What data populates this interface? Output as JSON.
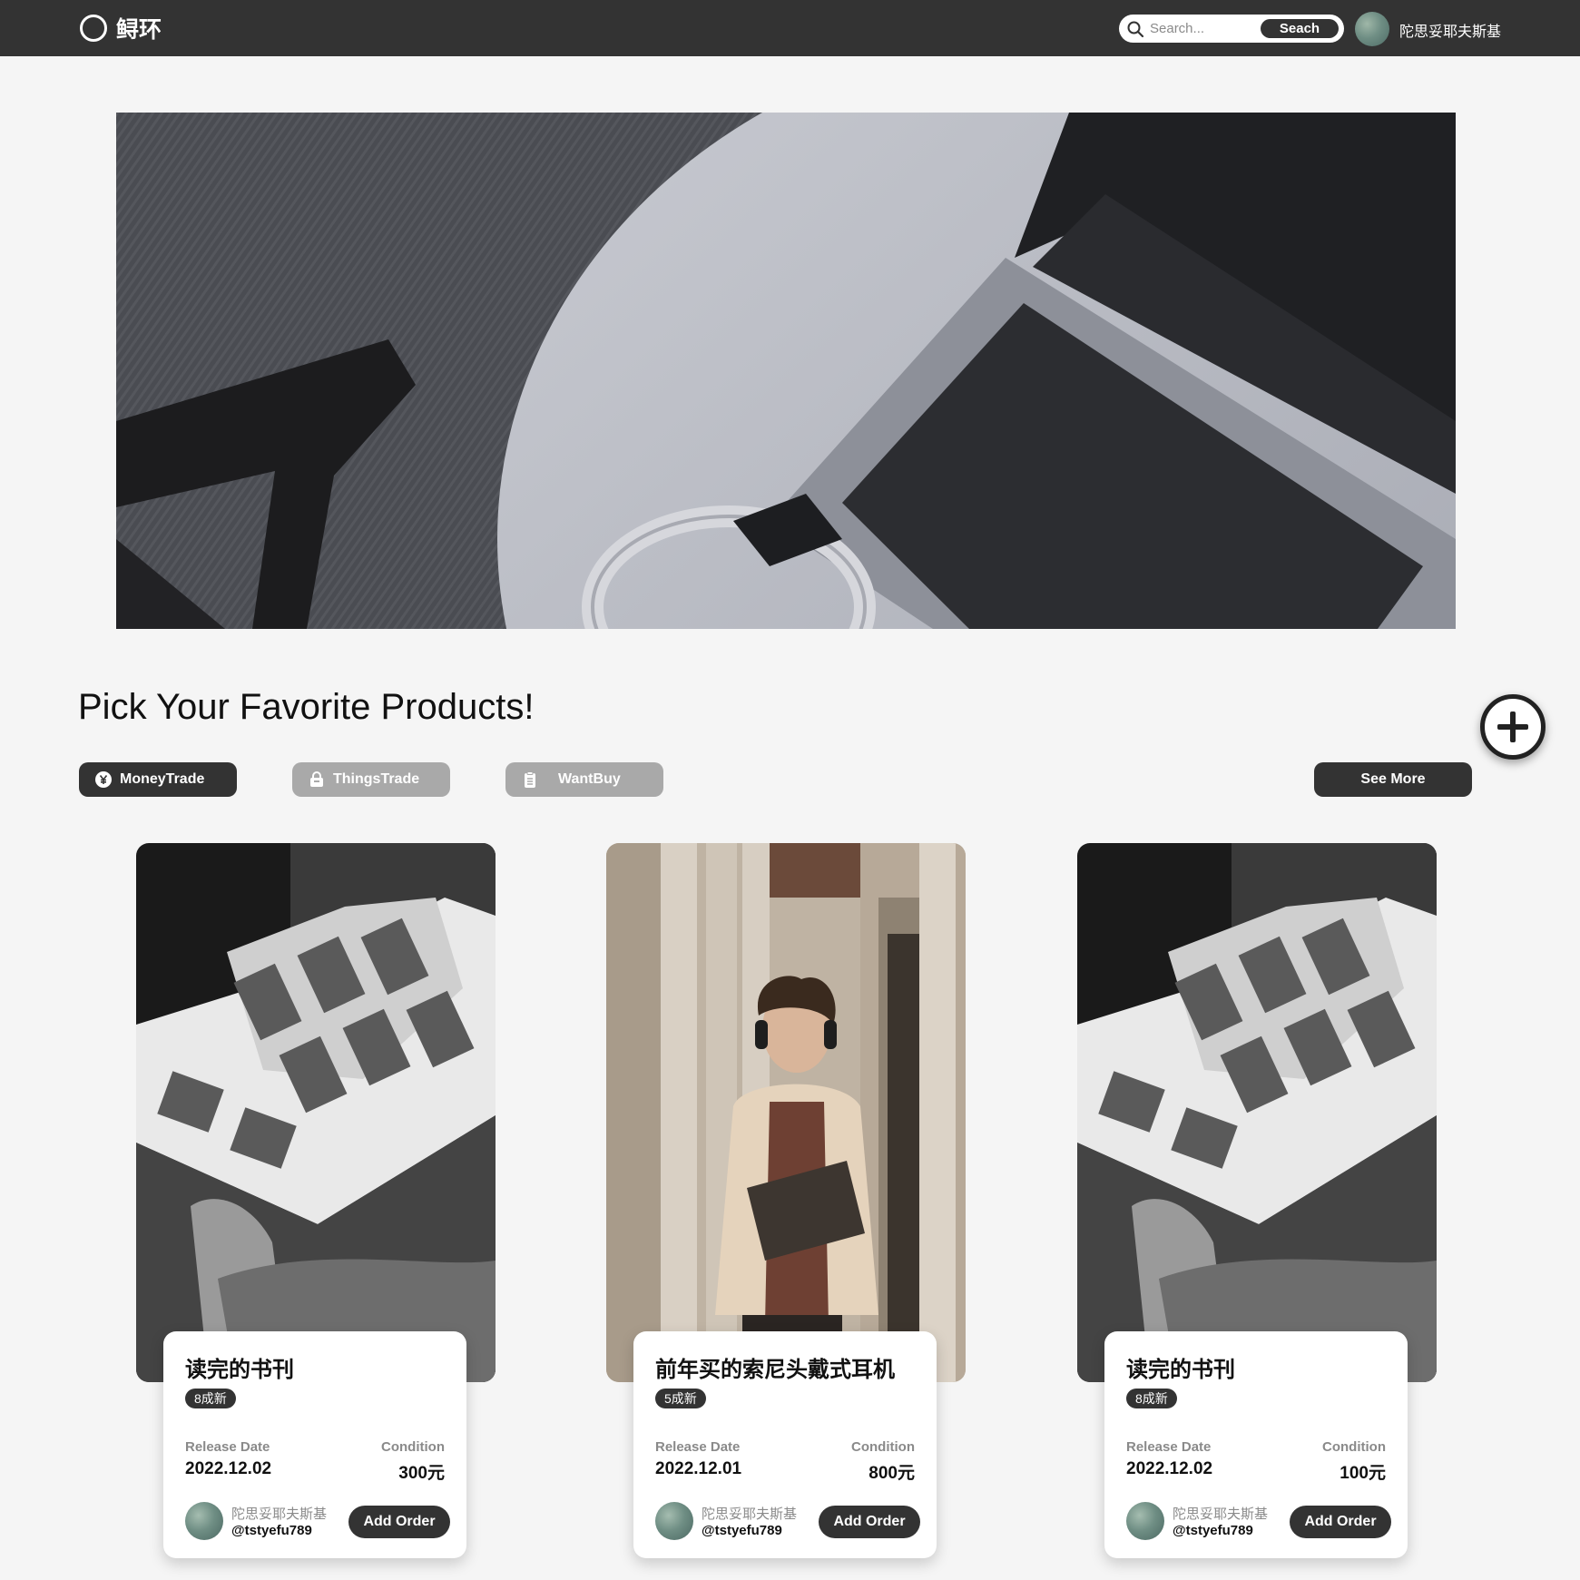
{
  "navbar": {
    "brand_name": "鲟环",
    "search_placeholder": "Search...",
    "search_button": "Seach",
    "username": "陀思妥耶夫斯基"
  },
  "hero": {
    "image": "laptop-on-round-table-photo"
  },
  "section": {
    "title": "Pick Your Favorite Products!",
    "filters": [
      {
        "label": "MoneyTrade",
        "icon": "yen-icon",
        "active": true
      },
      {
        "label": "ThingsTrade",
        "icon": "lock-bag-icon",
        "active": false
      },
      {
        "label": "WantBuy",
        "icon": "clipboard-icon",
        "active": false
      }
    ],
    "see_more": "See More"
  },
  "labels": {
    "release_date": "Release Date",
    "condition": "Condition",
    "add_order": "Add Order"
  },
  "products": [
    {
      "title": "读完的书刊",
      "badge": "8成新",
      "release_date": "2022.12.02",
      "price": "300元",
      "seller_name": "陀思妥耶夫斯基",
      "seller_handle": "@tstyefu789",
      "photo": "comic-book-photo"
    },
    {
      "title": "前年买的索尼头戴式耳机",
      "badge": "5成新",
      "release_date": "2022.12.01",
      "price": "800元",
      "seller_name": "陀思妥耶夫斯基",
      "seller_handle": "@tstyefu789",
      "photo": "person-with-headphones-photo"
    },
    {
      "title": "读完的书刊",
      "badge": "8成新",
      "release_date": "2022.12.02",
      "price": "100元",
      "seller_name": "陀思妥耶夫斯基",
      "seller_handle": "@tstyefu789",
      "photo": "comic-book-photo"
    }
  ],
  "colors": {
    "nav_bg": "#333333",
    "page_bg": "#f5f5f5",
    "inactive_pill": "#a9a9a9",
    "accent_dark": "#333333"
  }
}
